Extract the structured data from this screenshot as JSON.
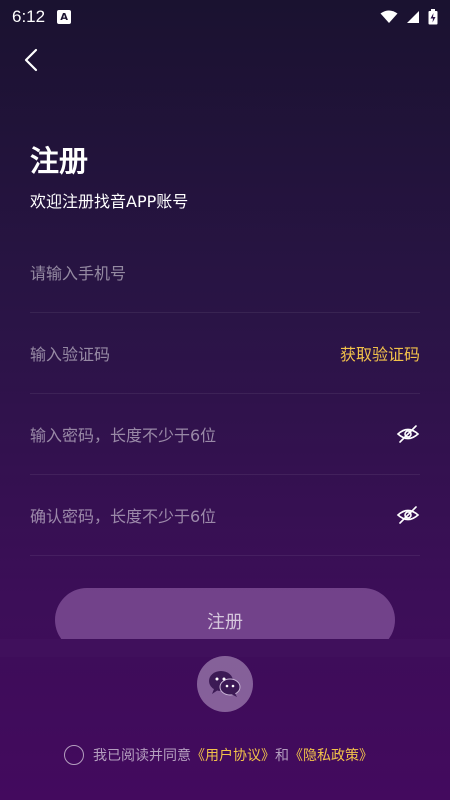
{
  "status": {
    "time": "6:12",
    "a_badge": "A"
  },
  "header": {
    "title": "注册",
    "subtitle": "欢迎注册找音APP账号"
  },
  "form": {
    "phone_placeholder": "请输入手机号",
    "code_placeholder": "输入验证码",
    "get_code_label": "获取验证码",
    "password_placeholder": "输入密码，长度不少于6位",
    "confirm_placeholder": "确认密码，长度不少于6位"
  },
  "submit_label": "注册",
  "agreement": {
    "prefix": "我已阅读并同意",
    "user_agreement": "《用户协议》",
    "conjunction": "和",
    "privacy_policy": "《隐私政策》"
  },
  "colors": {
    "accent": "#f2c24a",
    "bg_top": "#1a1230",
    "bg_bottom": "#430a5e"
  },
  "icons": [
    "back-arrow-icon",
    "eye-off-icon",
    "wechat-icon",
    "wifi-icon",
    "signal-icon",
    "battery-icon"
  ]
}
